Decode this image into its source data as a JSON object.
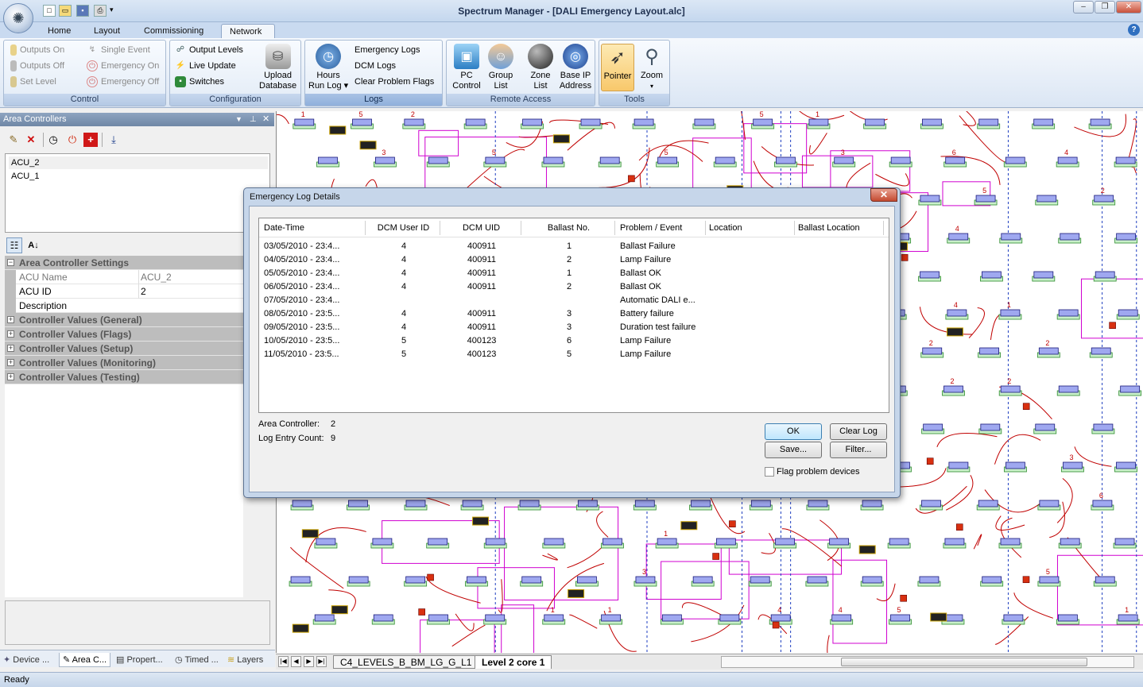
{
  "window": {
    "title": "Spectrum Manager - [DALI Emergency Layout.alc]"
  },
  "ribbon_tabs": [
    {
      "label": "Home"
    },
    {
      "label": "Layout"
    },
    {
      "label": "Commissioning"
    },
    {
      "label": "Network"
    }
  ],
  "ribbon": {
    "control": {
      "label": "Control",
      "outputs_on": "Outputs On",
      "outputs_off": "Outputs Off",
      "set_level": "Set Level",
      "single_event": "Single Event",
      "emergency_on": "Emergency On",
      "emergency_off": "Emergency Off"
    },
    "configuration": {
      "label": "Configuration",
      "output_levels": "Output Levels",
      "live_update": "Live Update",
      "switches": "Switches",
      "upload_database_1": "Upload",
      "upload_database_2": "Database"
    },
    "logs": {
      "label": "Logs",
      "hours_run_log_1": "Hours",
      "hours_run_log_2": "Run Log ▾",
      "emergency_logs": "Emergency Logs",
      "dcm_logs": "DCM Logs",
      "clear_problem_flags": "Clear Problem Flags"
    },
    "remote_access": {
      "label": "Remote Access",
      "pc_control_1": "PC",
      "pc_control_2": "Control",
      "group_list_1": "Group",
      "group_list_2": "List",
      "zone_list_1": "Zone",
      "zone_list_2": "List",
      "base_ip_1": "Base IP",
      "base_ip_2": "Address"
    },
    "tools": {
      "label": "Tools",
      "pointer": "Pointer",
      "zoom": "Zoom"
    }
  },
  "left_panel": {
    "title": "Area Controllers",
    "controllers": [
      "ACU_2",
      "ACU_1"
    ],
    "properties": {
      "section_title": "Area Controller Settings",
      "rows": [
        {
          "name": "ACU Name",
          "value": "ACU_2"
        },
        {
          "name": "ACU ID",
          "value": "2"
        },
        {
          "name": "Description",
          "value": ""
        }
      ],
      "categories": [
        "Controller Values (General)",
        "Controller Values (Flags)",
        "Controller Values (Setup)",
        "Controller Values (Monitoring)",
        "Controller Values (Testing)"
      ]
    },
    "bottom_tabs": [
      "Device ...",
      "Area C...",
      "Propert...",
      "Timed ...",
      "Layers"
    ]
  },
  "sheet_tabs": [
    "C4_LEVELS_B_BM_LG_G_L1",
    "Level 2 core 1"
  ],
  "status": "Ready",
  "dialog": {
    "title": "Emergency Log Details",
    "columns": [
      "Date-Time",
      "DCM User ID",
      "DCM UID",
      "Ballast No.",
      "Problem / Event",
      "Location",
      "Ballast Location"
    ],
    "rows": [
      [
        "03/05/2010 - 23:4...",
        "4",
        "400911",
        "1",
        "Ballast Failure",
        "",
        ""
      ],
      [
        "04/05/2010 - 23:4...",
        "4",
        "400911",
        "2",
        "Lamp Failure",
        "",
        ""
      ],
      [
        "05/05/2010 - 23:4...",
        "4",
        "400911",
        "1",
        "Ballast OK",
        "",
        ""
      ],
      [
        "06/05/2010 - 23:4...",
        "4",
        "400911",
        "2",
        "Ballast OK",
        "",
        ""
      ],
      [
        "07/05/2010 - 23:4...",
        "",
        "",
        "",
        "Automatic DALI e...",
        "",
        ""
      ],
      [
        "08/05/2010 - 23:5...",
        "4",
        "400911",
        "3",
        "Battery failure",
        "",
        ""
      ],
      [
        "09/05/2010 - 23:5...",
        "4",
        "400911",
        "3",
        "Duration test failure",
        "",
        ""
      ],
      [
        "10/05/2010 - 23:5...",
        "5",
        "400123",
        "6",
        "Lamp Failure",
        "",
        ""
      ],
      [
        "11/05/2010 - 23:5...",
        "5",
        "400123",
        "5",
        "Lamp Failure",
        "",
        ""
      ]
    ],
    "area_controller_label": "Area Controller:",
    "area_controller_value": "2",
    "log_entry_count_label": "Log Entry Count:",
    "log_entry_count_value": "9",
    "ok": "OK",
    "clear_log": "Clear Log",
    "save": "Save...",
    "filter": "Filter...",
    "flag_problem_devices": "Flag problem devices"
  }
}
